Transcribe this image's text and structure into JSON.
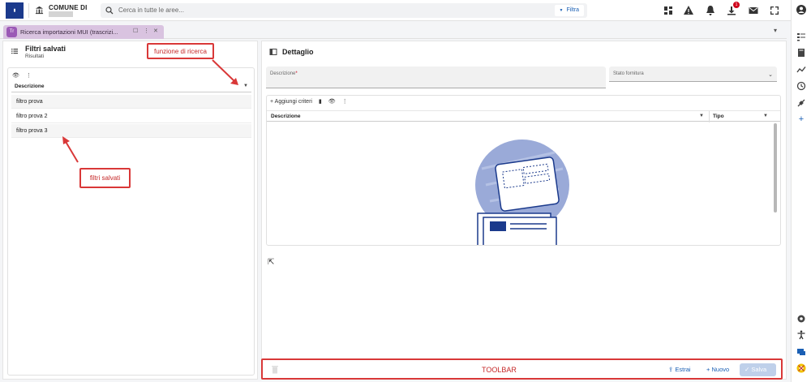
{
  "header": {
    "comune_label": "COMUNE DI",
    "search_placeholder": "Cerca in tutte le aree...",
    "filter_label": "Filtra",
    "notification_count": "1"
  },
  "tab": {
    "avatar": "Tr",
    "title": "Ricerca importazioni MUI (trascrizi..."
  },
  "left_panel": {
    "title": "Filtri salvati",
    "subtitle": "Risultati",
    "column_header": "Descrizione",
    "rows": [
      "filtro prova",
      "filtro prova 2",
      "filtro prova 3"
    ]
  },
  "right_panel": {
    "title": "Dettaglio",
    "descrizione_label": "Descrizione",
    "required_mark": "*",
    "stato_label": "Stato fornitura",
    "add_criteria_label": "Aggiungi criteri",
    "grid_columns": [
      "Descrizione",
      "Tipo"
    ]
  },
  "toolbar": {
    "label": "TOOLBAR",
    "estrai_label": "Estrai",
    "nuovo_label": "Nuovo",
    "salva_label": "Salva"
  },
  "annotations": {
    "search_function": "funzione di ricerca",
    "saved_filters": "filtri salvati"
  },
  "colors": {
    "annotation": "#d93838",
    "accent": "#1a5fb4",
    "tab": "#d9c3e0"
  }
}
